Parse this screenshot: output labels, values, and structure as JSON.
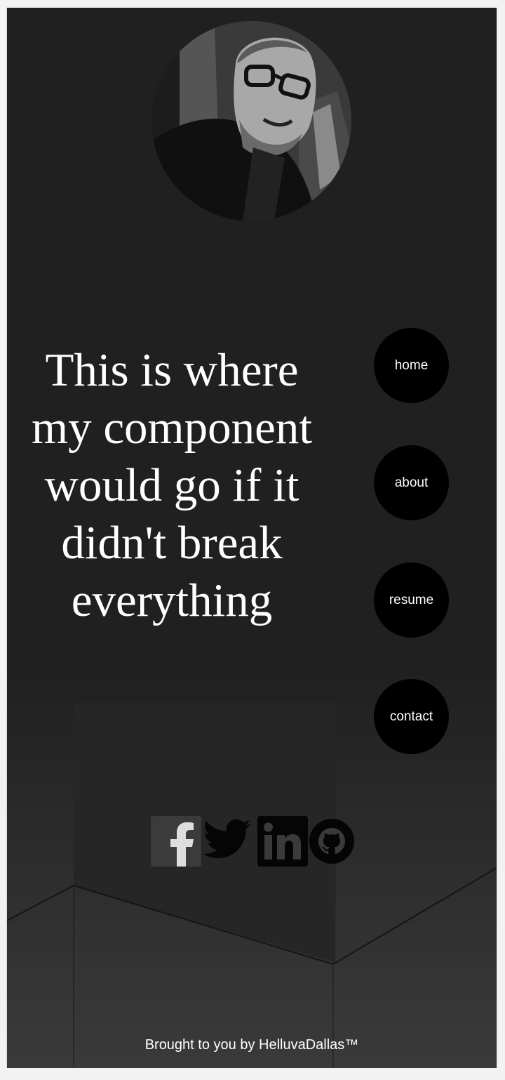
{
  "hero": {
    "message": "This is where my component would go if it didn't break everything",
    "avatar_alt": "profile-photo"
  },
  "nav": {
    "items": [
      {
        "label": "home"
      },
      {
        "label": "about"
      },
      {
        "label": "resume"
      },
      {
        "label": "contact"
      }
    ]
  },
  "social": {
    "icons": [
      "facebook-icon",
      "twitter-icon",
      "linkedin-icon",
      "github-icon"
    ]
  },
  "footer": {
    "text": "Brought to you by HelluvaDallas™"
  },
  "colors": {
    "page_bg": "#202020",
    "nav_button_bg": "#000000",
    "text": "#ffffff"
  }
}
